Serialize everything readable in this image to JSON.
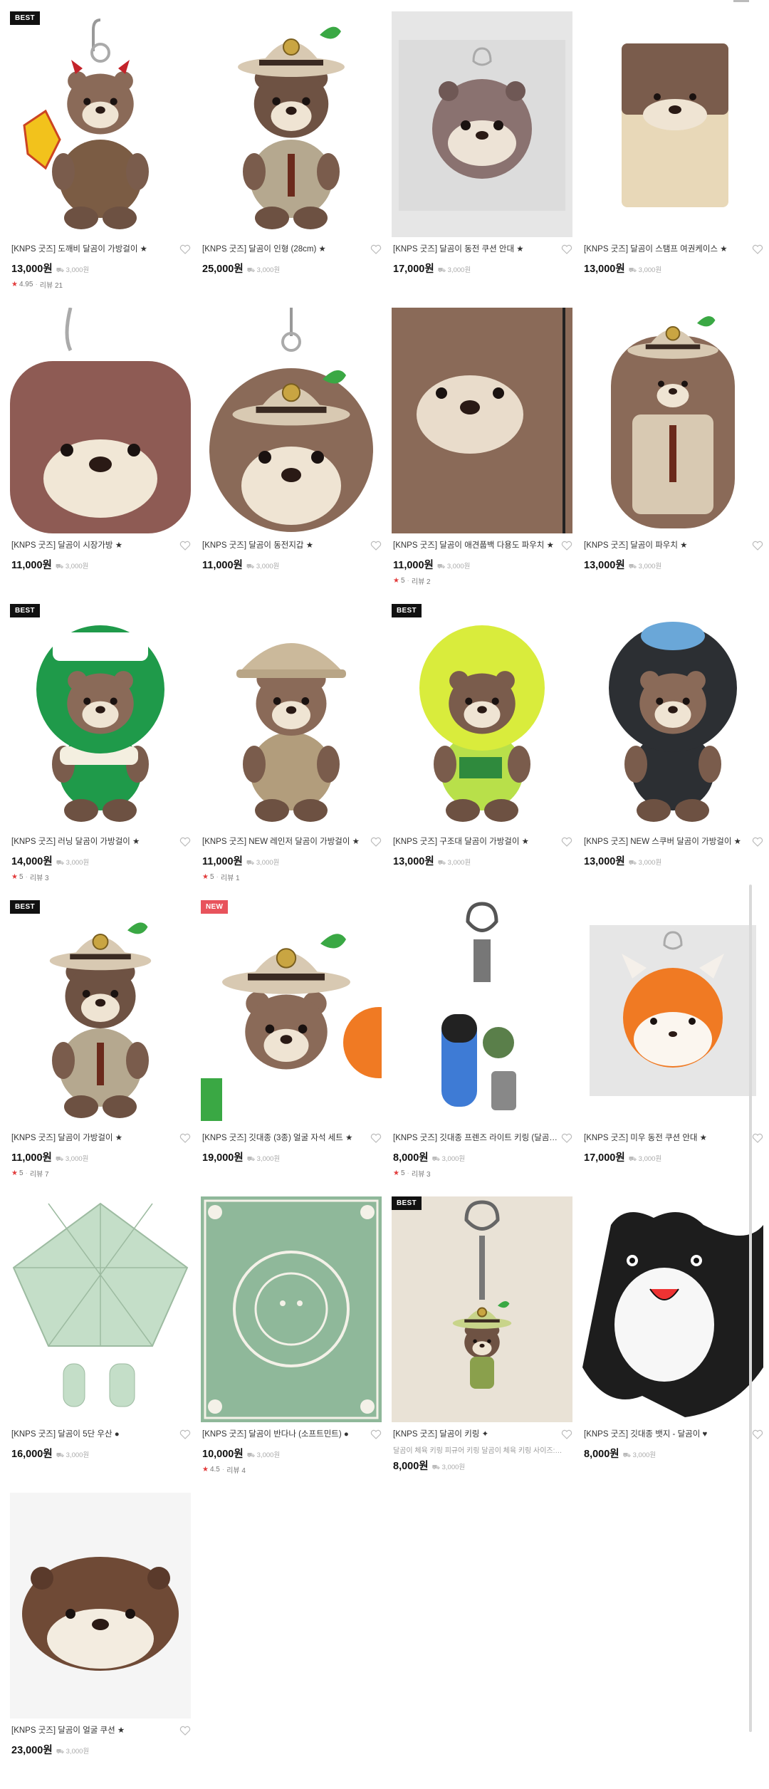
{
  "shipping_label": "3,000원",
  "products": [
    {
      "name": "[KNPS 굿즈] 도깨비 달곰이 가방걸이 ★",
      "price": "13,000원",
      "badge": "BEST",
      "rating": "4.95",
      "reviews": "리뷰 21",
      "art": "bear-devil"
    },
    {
      "name": "[KNPS 굿즈] 달곰이 인형 (28cm) ★",
      "price": "25,000원",
      "badge": "",
      "art": "bear-ranger-big"
    },
    {
      "name": "[KNPS 굿즈] 달곰이 동전 쿠션 안대 ★",
      "price": "17,000원",
      "badge": "",
      "art": "round-otter"
    },
    {
      "name": "[KNPS 굿즈] 달곰이 스탬프 여권케이스 ★",
      "price": "13,000원",
      "badge": "",
      "art": "passport"
    },
    {
      "name": "[KNPS 굿즈] 달곰이 시장가방 ★",
      "price": "11,000원",
      "badge": "",
      "art": "pouch-otter"
    },
    {
      "name": "[KNPS 굿즈] 달곰이 동전지갑 ★",
      "price": "11,000원",
      "badge": "",
      "art": "coin-ranger"
    },
    {
      "name": "[KNPS 굿즈] 달곰이 애견풉백 다용도 파우치 ★",
      "price": "11,000원",
      "badge": "",
      "rating": "5",
      "reviews": "리뷰 2",
      "art": "pouch-close"
    },
    {
      "name": "[KNPS 굿즈] 달곰이 파우치 ★",
      "price": "13,000원",
      "badge": "",
      "art": "pouch-ranger"
    },
    {
      "name": "[KNPS 굿즈] 러닝 달곰이 가방걸이 ★",
      "price": "14,000원",
      "badge": "BEST",
      "rating": "5",
      "reviews": "리뷰 3",
      "art": "bear-green"
    },
    {
      "name": "[KNPS 굿즈] NEW 레인저 달곰이 가방걸이 ★",
      "price": "11,000원",
      "badge": "",
      "rating": "5",
      "reviews": "리뷰 1",
      "art": "bear-cap"
    },
    {
      "name": "[KNPS 굿즈] 구조대 달곰이 가방걸이 ★",
      "price": "13,000원",
      "badge": "BEST",
      "art": "bear-yellow"
    },
    {
      "name": "[KNPS 굿즈] NEW 스쿠버 달곰이 가방걸이 ★",
      "price": "13,000원",
      "badge": "",
      "art": "bear-scuba"
    },
    {
      "name": "[KNPS 굿즈] 달곰이 가방걸이 ★",
      "price": "11,000원",
      "badge": "BEST",
      "rating": "5",
      "reviews": "리뷰 7",
      "art": "bear-ranger"
    },
    {
      "name": "[KNPS 굿즈] 깃대종 (3종) 얼굴 자석 세트 ★",
      "price": "19,000원",
      "badge": "NEW",
      "art": "magnet"
    },
    {
      "name": "[KNPS 굿즈] 깃대종 프렌즈 라이트 키링 (달곰이) ●",
      "price": "8,000원",
      "badge": "",
      "rating": "5",
      "reviews": "리뷰 3",
      "art": "keyring-light"
    },
    {
      "name": "[KNPS 굿즈] 미우 동전 쿠션 안대 ★",
      "price": "17,000원",
      "badge": "",
      "art": "fox"
    },
    {
      "name": "[KNPS 굿즈] 달곰이 5단 우산 ●",
      "price": "16,000원",
      "badge": "",
      "art": "umbrella"
    },
    {
      "name": "[KNPS 굿즈] 달곰이 반다나 (소프트민트) ●",
      "price": "10,000원",
      "badge": "",
      "rating": "4.5",
      "reviews": "리뷰 4",
      "art": "bandana"
    },
    {
      "name": "[KNPS 굿즈] 달곰이 키링 ✦",
      "price": "8,000원",
      "badge": "BEST",
      "desc": "달곰이 체육 키링 피규어 키링 달곰이 체육 키링 사이즈: 가...",
      "art": "keyring-figure"
    },
    {
      "name": "[KNPS 굿즈] 깃대종 뱃지 - 달곰이 ♥",
      "price": "8,000원",
      "badge": "",
      "art": "badge-otter"
    },
    {
      "name": "[KNPS 굿즈] 달곰이 얼굴 쿠션 ★",
      "price": "23,000원",
      "badge": "",
      "art": "cushion"
    }
  ],
  "icons": {
    "heart": "heart-outline-icon",
    "star": "star-filled-icon",
    "shipping": "truck-icon"
  },
  "colors": {
    "badge_best": "#111111",
    "badge_new": "#e8535c",
    "star": "#e23b3b"
  }
}
